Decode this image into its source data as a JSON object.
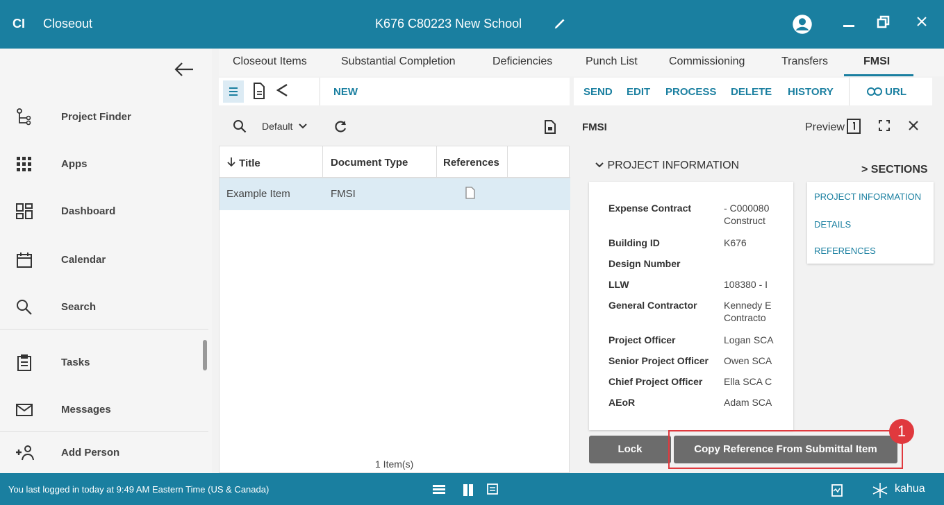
{
  "header": {
    "logo": "CI",
    "app_name": "Closeout",
    "project_title": "K676 C80223 New School",
    "icons": [
      "pencil-icon",
      "user-avatar-icon",
      "minimize-icon",
      "restore-icon",
      "close-icon"
    ]
  },
  "sidebar": {
    "items": [
      {
        "label": "Project Finder",
        "icon": "project-finder-icon"
      },
      {
        "label": "Apps",
        "icon": "apps-grid-icon"
      },
      {
        "label": "Dashboard",
        "icon": "dashboard-icon"
      },
      {
        "label": "Calendar",
        "icon": "calendar-icon"
      },
      {
        "label": "Search",
        "icon": "search-icon"
      },
      {
        "label": "Tasks",
        "icon": "clipboard-icon"
      },
      {
        "label": "Messages",
        "icon": "envelope-icon"
      },
      {
        "label": "Add Person",
        "icon": "add-person-icon"
      }
    ]
  },
  "tabs": [
    "Closeout Items",
    "Substantial Completion",
    "Deficiencies",
    "Punch List",
    "Commissioning",
    "Transfers",
    "FMSI"
  ],
  "active_tab": "FMSI",
  "toolbar": {
    "new_label": "NEW",
    "actions": [
      "SEND",
      "EDIT",
      "PROCESS",
      "DELETE",
      "HISTORY"
    ],
    "url_label": "URL"
  },
  "list": {
    "view_name": "Default",
    "columns": [
      "Title",
      "Document Type",
      "References"
    ],
    "rows": [
      {
        "title": "Example Item",
        "document_type": "FMSI"
      }
    ],
    "count_label": "1 Item(s)"
  },
  "detail": {
    "name": "FMSI",
    "preview_label": "Preview",
    "section_title": "PROJECT INFORMATION",
    "sections_label": "> SECTIONS",
    "fields": [
      {
        "key": "Expense Contract",
        "value": "- C000080",
        "value2": "Construct"
      },
      {
        "key": "Building ID",
        "value": "K676"
      },
      {
        "key": "Design Number",
        "value": ""
      },
      {
        "key": "LLW",
        "value": "108380 - I"
      },
      {
        "key": "General Contractor",
        "value": "Kennedy E",
        "value2": "Contracto"
      },
      {
        "key": "Project Officer",
        "value": "Logan SCA"
      },
      {
        "key": "Senior Project Officer",
        "value": "Owen SCA"
      },
      {
        "key": "Chief Project Officer",
        "value": "Ella SCA C"
      },
      {
        "key": "AEoR",
        "value": "Adam SCA"
      }
    ],
    "section_links": [
      "PROJECT INFORMATION",
      "DETAILS",
      "REFERENCES"
    ],
    "lock_label": "Lock",
    "copy_label": "Copy Reference From Submittal Item",
    "badge_number": "1"
  },
  "status": {
    "message": "You last logged in today at 9:49 AM Eastern Time (US & Canada)",
    "brand": "kahua"
  },
  "colors": {
    "primary": "#1a7fa0",
    "highlight": "#e0393e",
    "row_selected": "#dcebf4",
    "button_gray": "#6c6c6c"
  }
}
